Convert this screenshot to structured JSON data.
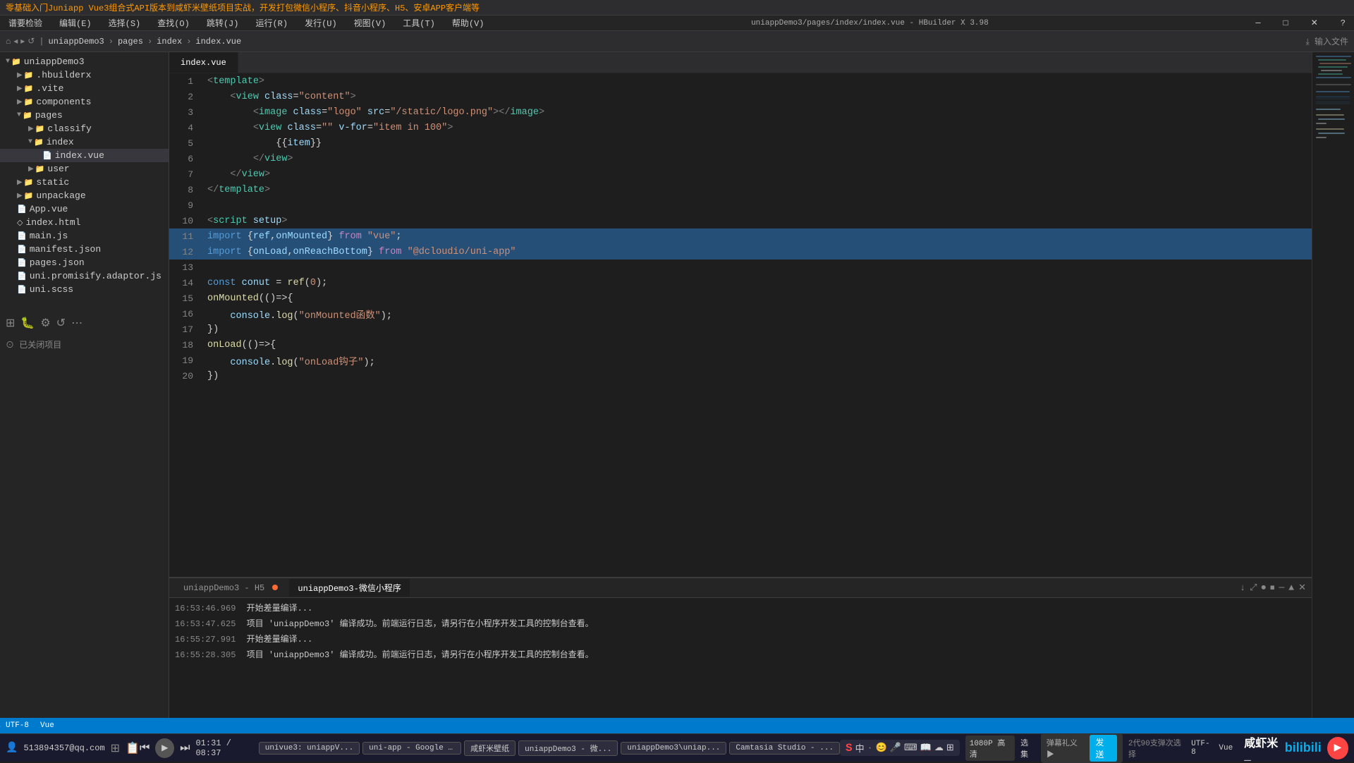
{
  "app": {
    "title": "uniappDemo3/pages/index/index.vue - HBuilder X 3.98",
    "banner": "零基础入门Juniapp Vue3组合式API版本到咸虾米壁纸项目实战，开发打包微信小程序、抖音小程序、H5、安卓APP客户端等"
  },
  "menu": {
    "items": [
      "谱要检验",
      "编辑(E)",
      "选择(S)",
      "查找(O)",
      "跳转(J)",
      "运行(R)",
      "发行(U)",
      "视图(V)",
      "工具(T)",
      "帮助(V)"
    ]
  },
  "toolbar": {
    "breadcrumbs": [
      "uniappDemo3",
      "pages",
      "index",
      "index.vue"
    ]
  },
  "tabs": [
    {
      "label": "index.vue",
      "active": true
    }
  ],
  "sidebar": {
    "title": "uniappDemo3",
    "items": [
      {
        "label": ".hbuilderx",
        "type": "folder",
        "indent": 1,
        "expanded": false
      },
      {
        "label": ".vite",
        "type": "folder",
        "indent": 1,
        "expanded": false
      },
      {
        "label": "components",
        "type": "folder",
        "indent": 1,
        "expanded": false
      },
      {
        "label": "pages",
        "type": "folder",
        "indent": 1,
        "expanded": true
      },
      {
        "label": "classify",
        "type": "folder",
        "indent": 2,
        "expanded": false
      },
      {
        "label": "index",
        "type": "folder",
        "indent": 2,
        "expanded": true
      },
      {
        "label": "index.vue",
        "type": "file",
        "indent": 3,
        "active": true
      },
      {
        "label": "user",
        "type": "folder",
        "indent": 2,
        "expanded": false
      },
      {
        "label": "static",
        "type": "folder",
        "indent": 1,
        "expanded": false
      },
      {
        "label": "unpackage",
        "type": "folder",
        "indent": 1,
        "expanded": false
      },
      {
        "label": "App.vue",
        "type": "file",
        "indent": 1
      },
      {
        "label": "index.html",
        "type": "file",
        "indent": 1
      },
      {
        "label": "main.js",
        "type": "file",
        "indent": 1
      },
      {
        "label": "manifest.json",
        "type": "file",
        "indent": 1
      },
      {
        "label": "pages.json",
        "type": "file",
        "indent": 1
      },
      {
        "label": "uni.promisify.adaptor.js",
        "type": "file",
        "indent": 1
      },
      {
        "label": "uni.scss",
        "type": "file",
        "indent": 1
      }
    ]
  },
  "code": {
    "lines": [
      {
        "num": 1,
        "content": "<template>",
        "highlight": false
      },
      {
        "num": 2,
        "content": "    <view class=\"content\">",
        "highlight": false
      },
      {
        "num": 3,
        "content": "        <image class=\"logo\" src=\"/static/logo.png\"></image>",
        "highlight": false
      },
      {
        "num": 4,
        "content": "        <view class=\"\" v-for=\"item in 100\">",
        "highlight": false
      },
      {
        "num": 5,
        "content": "            {{item}}",
        "highlight": false
      },
      {
        "num": 6,
        "content": "        </view>",
        "highlight": false
      },
      {
        "num": 7,
        "content": "    </view>",
        "highlight": false
      },
      {
        "num": 8,
        "content": "</template>",
        "highlight": false
      },
      {
        "num": 9,
        "content": "",
        "highlight": false
      },
      {
        "num": 10,
        "content": "<script setup>",
        "highlight": false
      },
      {
        "num": 11,
        "content": "import {ref,onMounted} from \"vue\";",
        "highlight": true
      },
      {
        "num": 12,
        "content": "import {onLoad,onReachBottom} from \"@dcloudio/uni-app\"",
        "highlight": true
      },
      {
        "num": 13,
        "content": "",
        "highlight": false
      },
      {
        "num": 14,
        "content": "const conut = ref(0);",
        "highlight": false
      },
      {
        "num": 15,
        "content": "onMounted(()=>{",
        "highlight": false
      },
      {
        "num": 16,
        "content": "    console.log(\"onMounted函数\");",
        "highlight": false
      },
      {
        "num": 17,
        "content": "})",
        "highlight": false
      },
      {
        "num": 18,
        "content": "onLoad(()=>{",
        "highlight": false
      },
      {
        "num": 19,
        "content": "    console.log(\"onLoad钩子\");",
        "highlight": false
      },
      {
        "num": 20,
        "content": "})",
        "highlight": false
      }
    ]
  },
  "bottom_panel": {
    "tabs": [
      {
        "label": "uniappDemo3 - H5",
        "active": false,
        "has_dot": true
      },
      {
        "label": "uniappDemo3-微信小程序",
        "active": true
      }
    ],
    "console_lines": [
      {
        "time": "16:53:46.969",
        "text": "开始差量编译..."
      },
      {
        "time": "16:53:47.625",
        "text": "项目 'uniappDemo3' 编译成功。前端运行日志，请另行在小程序开发工具的控制台查看。"
      },
      {
        "time": "16:55:27.991",
        "text": "开始差量编译..."
      },
      {
        "time": "16:55:28.305",
        "text": "项目 'uniappDemo3' 编译成功。前端运行日志，请另行在小程序开发工具的控制台查看。"
      }
    ]
  },
  "status_bar": {
    "left": "已关闭项目",
    "right_items": [
      "UTF-8",
      "Vue"
    ]
  },
  "taskbar": {
    "user_qq": "513894357@qq.com",
    "time_current": "01:31 / 08:37",
    "apps": [
      {
        "label": "univue3: uniappV..."
      },
      {
        "label": "uni-app - Google ..."
      },
      {
        "label": "咸虾米壁纸"
      },
      {
        "label": "uniappDemo3 - 微..."
      },
      {
        "label": "uniappDemo3\\uniap..."
      },
      {
        "label": "Camtasia Studio - ..."
      }
    ],
    "right_items": [
      "1080P 高清",
      "选集",
      "弹幕礼义 ▶ 发送",
      "2代90支弹次选择",
      "UTF-8",
      "Vue"
    ],
    "input_method": "中"
  },
  "bilibili": {
    "username": "咸虾米_",
    "logo_text": "bilibili"
  },
  "icons": {
    "play": "▶",
    "prev": "⏮",
    "next": "⏭",
    "folder_open": "▼",
    "folder_closed": "▶",
    "chevron_right": "›",
    "close": "✕",
    "minimize": "─",
    "maximize": "□"
  }
}
